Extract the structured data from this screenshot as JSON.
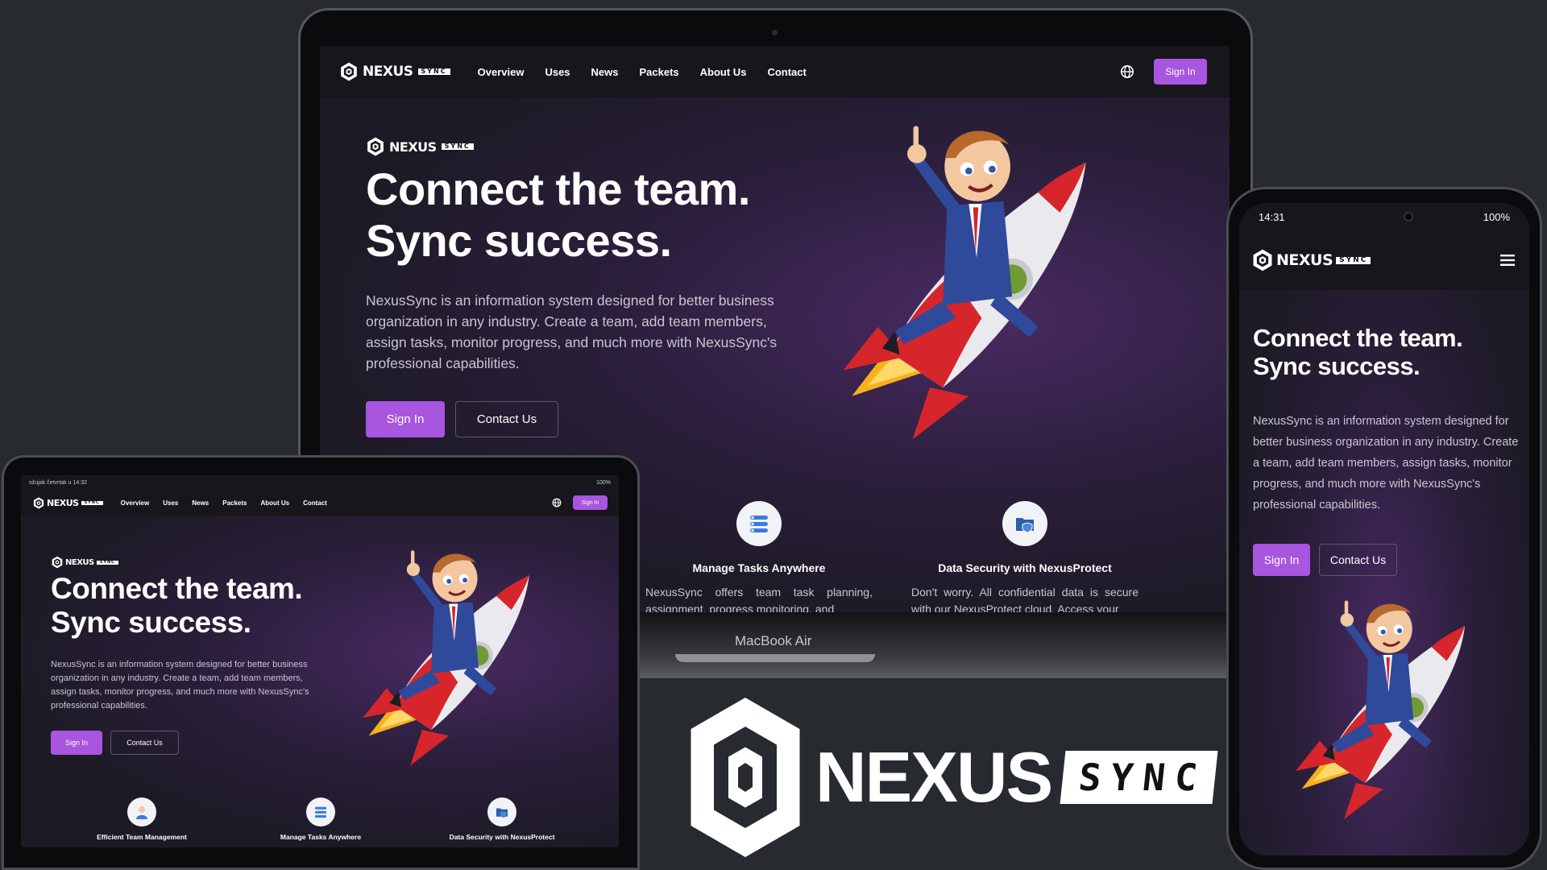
{
  "brand": {
    "name": "NEXUS",
    "tag": "SYNC"
  },
  "nav": {
    "links": [
      "Overview",
      "Uses",
      "News",
      "Packets",
      "About Us",
      "Contact"
    ],
    "signin": "Sign In"
  },
  "hero": {
    "title_line1": "Connect the team.",
    "title_line2": "Sync success.",
    "description": "NexusSync is an information system designed for better business organization in any industry. Create a team, add team members, assign tasks, monitor progress, and much more with NexusSync's professional capabilities.",
    "primary_cta": "Sign In",
    "secondary_cta": "Contact Us"
  },
  "features": [
    {
      "title": "Efficient Team Management",
      "icon": "team-icon"
    },
    {
      "title": "Manage Tasks Anywhere",
      "icon": "tasks-icon",
      "text": "NexusSync offers team task planning, assignment, progress monitoring, and"
    },
    {
      "title": "Data Security with NexusProtect",
      "icon": "shield-folder-icon",
      "text": "Don't worry. All confidential data is secure with our NexusProtect cloud. Access your"
    }
  ],
  "laptop": {
    "label": "MacBook Air"
  },
  "tablet": {
    "status_left": "ožujak četvrtak u 14:32",
    "status_right": "100%"
  },
  "phone": {
    "time": "14:31",
    "battery": "100%"
  },
  "colors": {
    "accent": "#a855e0",
    "background": "#272b30",
    "navbar": "#17161b"
  }
}
